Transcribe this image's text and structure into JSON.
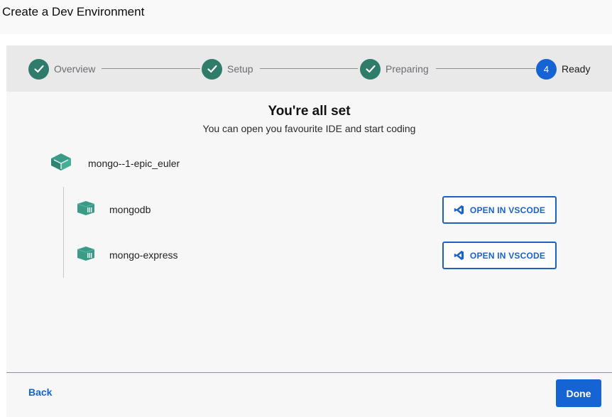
{
  "window": {
    "title": "Create a Dev Environment"
  },
  "stepper": {
    "steps": [
      {
        "label": "Overview",
        "state": "done"
      },
      {
        "label": "Setup",
        "state": "done"
      },
      {
        "label": "Preparing",
        "state": "done"
      },
      {
        "label": "Ready",
        "state": "active",
        "number": "4"
      }
    ]
  },
  "main": {
    "heading": "You're all set",
    "subheading": "You can open you favourite IDE and start coding",
    "environment": {
      "name": "mongo--1-epic_euler",
      "icon": "box-stack-icon",
      "services": [
        {
          "name": "mongodb",
          "icon": "container-icon",
          "button_label": "OPEN IN VSCODE"
        },
        {
          "name": "mongo-express",
          "icon": "container-icon",
          "button_label": "OPEN IN VSCODE"
        }
      ]
    }
  },
  "footer": {
    "back_label": "Back",
    "done_label": "Done"
  },
  "colors": {
    "accent": "#1663d4",
    "step_done": "#2f7c6a",
    "container_icon": "#3a9b86"
  }
}
